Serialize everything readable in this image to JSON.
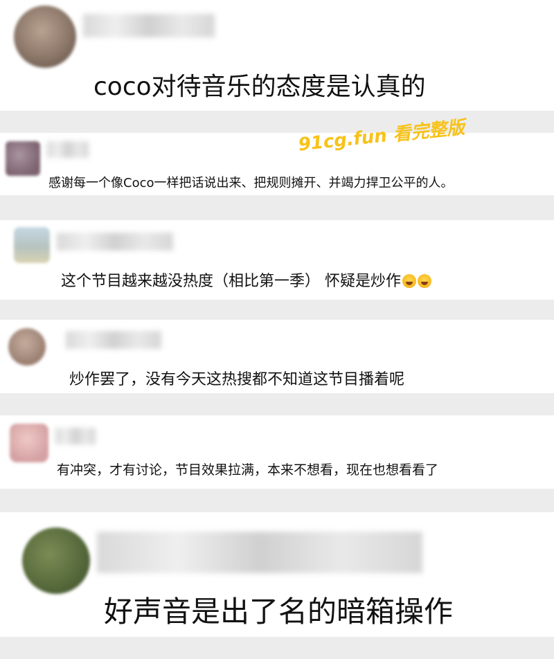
{
  "comments": [
    {
      "text": "coco对待音乐的态度是认真的",
      "avatar_color": "#8b7668"
    },
    {
      "text": "感谢每一个像Coco一样把话说出来、把规则摊开、并竭力捍卫公平的人。",
      "avatar_color": "#8a7380"
    },
    {
      "text": "这个节目越来越没热度（相比第一季） 怀疑是炒作",
      "avatar_color": "#b9c6cf"
    },
    {
      "text": "炒作罢了，没有今天这热搜都不知道这节目播着呢",
      "avatar_color": "#a68b7c"
    },
    {
      "text": "有冲突，才有讨论，节目效果拉满，本来不想看，现在也想看看了",
      "avatar_color": "#d8a6a8"
    },
    {
      "text": "好声音是出了名的暗箱操作",
      "avatar_color": "#5b6f3e"
    }
  ],
  "watermark": "91cg.fun 看完整版",
  "emoji_name": "laughing-crying-emoji"
}
